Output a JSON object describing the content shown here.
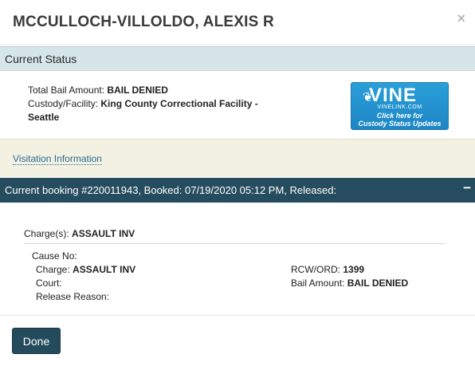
{
  "modal": {
    "title": "MCCULLOCH-VILLOLDO, ALEXIS R",
    "close_label": "×"
  },
  "status": {
    "heading": "Current Status",
    "bail_label": "Total Bail Amount:",
    "bail_value": "BAIL DENIED",
    "custody_label": "Custody/Facility:",
    "custody_value": "King County Correctional Facility - Seattle"
  },
  "vine": {
    "word": "VINE",
    "leaf": "❦",
    "url": "VINELINK.COM",
    "cta_line1": "Click here for",
    "cta_line2": "Custody Status Updates"
  },
  "visitation": {
    "link_text": "Visitation Information"
  },
  "booking": {
    "header": "Current booking #220011943, Booked: 07/19/2020 05:12 PM, Released:",
    "collapse_label": "−",
    "charges_label": "Charge(s):",
    "charges_value": "ASSAULT INV",
    "cause_label": "Cause No:",
    "cause_value": "",
    "charge_label": "Charge:",
    "charge_value": "ASSAULT INV",
    "court_label": "Court:",
    "court_value": "",
    "release_label": "Release Reason:",
    "release_value": "",
    "rcw_label": "RCW/ORD:",
    "rcw_value": "1399",
    "bail_label": "Bail Amount:",
    "bail_value": "BAIL DENIED"
  },
  "footer": {
    "done_label": "Done"
  }
}
